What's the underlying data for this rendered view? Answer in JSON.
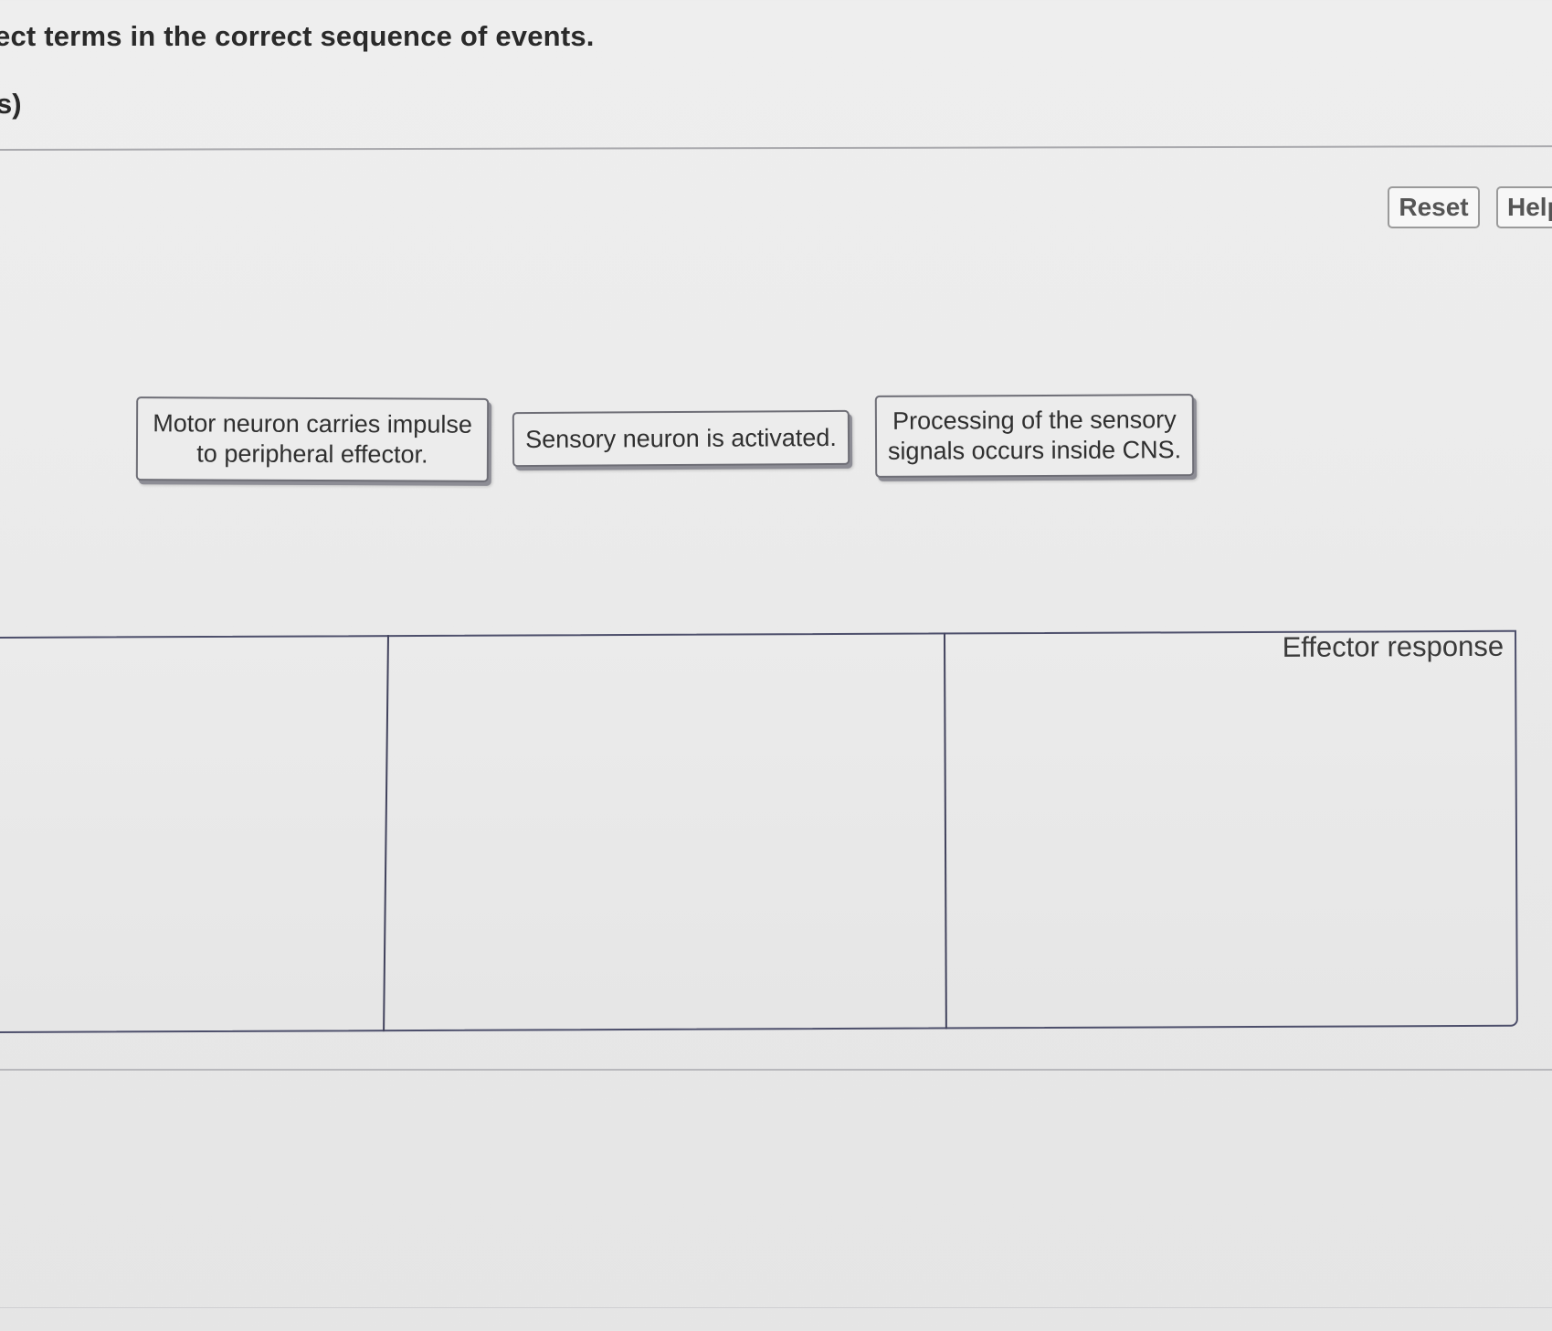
{
  "question": {
    "instruction": "ect terms in the correct sequence of events.",
    "points_fragment": "s)"
  },
  "toolbar": {
    "reset_label": "Reset",
    "help_label": "Help"
  },
  "terms": [
    {
      "label": "Motor neuron carries impulse to peripheral effector."
    },
    {
      "label": "Sensory neuron is activated."
    },
    {
      "label": "Processing of the sensory signals occurs inside CNS."
    }
  ],
  "sequence_slots": [
    {
      "label": ""
    },
    {
      "label": ""
    },
    {
      "label": "Effector response"
    }
  ]
}
